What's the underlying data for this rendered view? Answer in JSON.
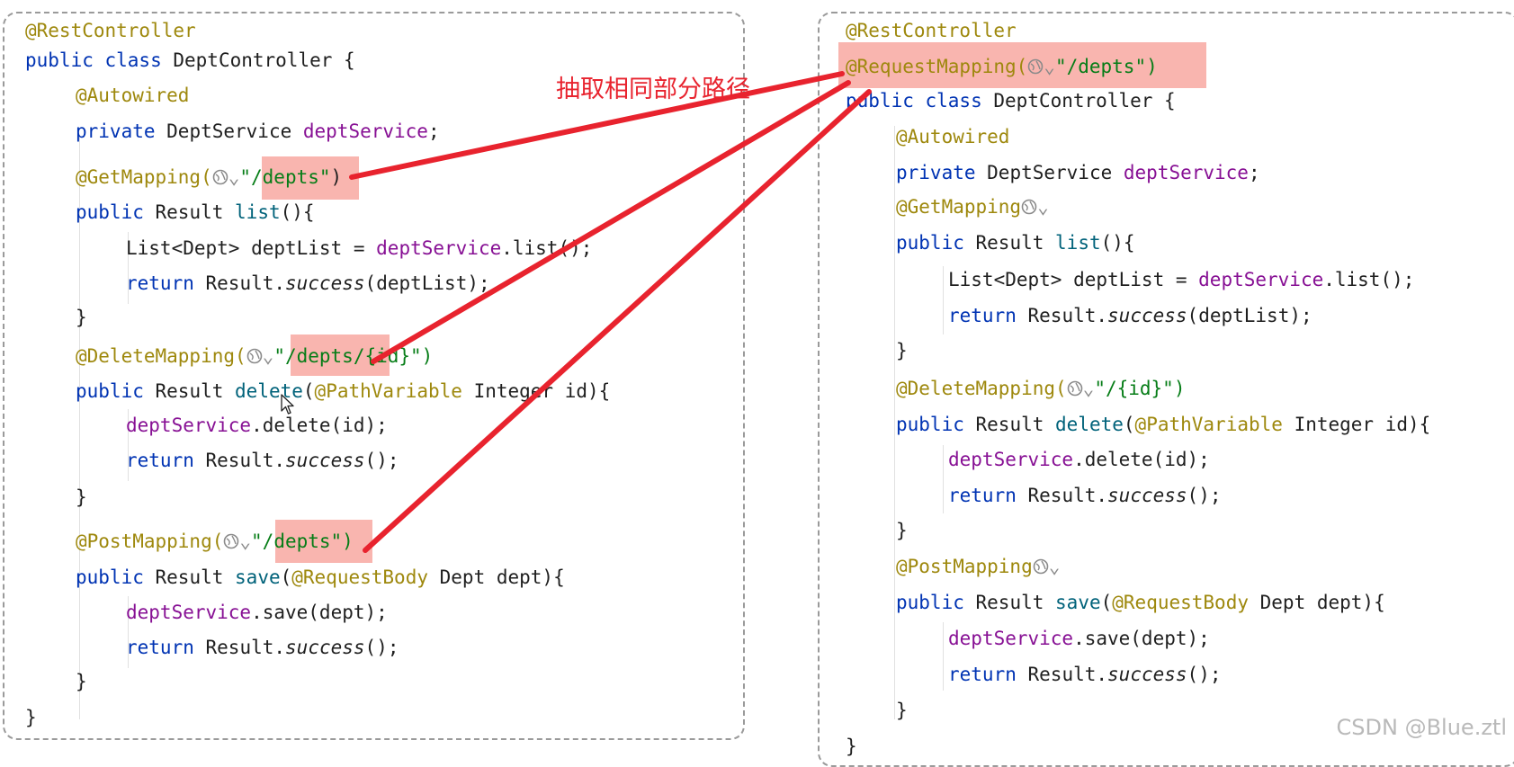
{
  "left_panel": {
    "lines": [
      "@RestController",
      "public class DeptController {",
      "@Autowired",
      "private DeptService deptService;",
      "@GetMapping(",
      "\"/depts\"",
      "public Result list(){",
      "List<Dept> deptList = deptService.list();",
      "return Result.success(deptList);",
      "}",
      "@DeleteMapping(",
      "\"/depts/{id}\")",
      "public Result delete(@PathVariable Integer id){",
      "deptService.delete(id);",
      "return Result.success();",
      "}",
      "@PostMapping(",
      "\"/depts\")",
      "public Result save(@RequestBody Dept dept){",
      "deptService.save(dept);",
      "return Result.success();",
      "}",
      "}"
    ]
  },
  "right_panel": {
    "lines": [
      "@RestController",
      "@RequestMapping(",
      "\"/depts\")",
      "public class DeptController {",
      "@Autowired",
      "private DeptService deptService;",
      "@GetMapping",
      "public Result list(){",
      "List<Dept> deptList = deptService.list();",
      "return Result.success(deptList);",
      "}",
      "@DeleteMapping(",
      "\"/{id}\")",
      "public Result delete(@PathVariable Integer id){",
      "deptService.delete(id);",
      "return Result.success();",
      "}",
      "@PostMapping",
      "public Result save(@RequestBody Dept dept){",
      "deptService.save(dept);",
      "return Result.success();",
      "}",
      "}"
    ]
  },
  "caption": "抽取相同部分路径",
  "watermark": "CSDN @Blue.ztl",
  "colors": {
    "annotation": "#9e880d",
    "keyword": "#0033b3",
    "field": "#871094",
    "string": "#067d17",
    "arrow": "#e8232e",
    "highlight": "#f4786e"
  },
  "icons": [
    "globe-icon",
    "chevron-down-icon",
    "mouse-cursor-icon"
  ]
}
